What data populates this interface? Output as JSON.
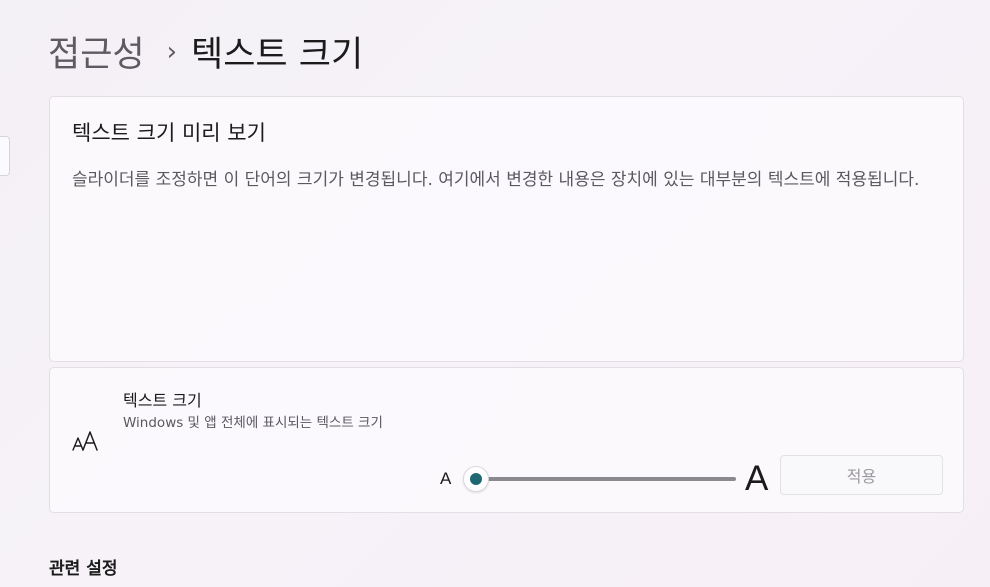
{
  "breadcrumb": {
    "parent": "접근성",
    "separator": "›",
    "current": "텍스트 크기"
  },
  "preview": {
    "title": "텍스트 크기 미리 보기",
    "body": "슬라이더를 조정하면 이 단어의 크기가 변경됩니다. 여기에서 변경한 내용은 장치에 있는 대부분의 텍스트에 적용됩니다."
  },
  "text_size_setting": {
    "icon": "text-size-icon",
    "title": "텍스트 크기",
    "description": "Windows 및 앱 전체에 표시되는 텍스트 크기",
    "slider": {
      "min_label": "A",
      "max_label": "A",
      "value_percent": 100,
      "fraction": 0.0
    },
    "apply_label": "적용",
    "apply_enabled": false
  },
  "related_settings": {
    "heading": "관련 설정"
  },
  "colors": {
    "accent": "#1f6873",
    "track": "#8b888e",
    "disabled_text": "#9c999f"
  }
}
